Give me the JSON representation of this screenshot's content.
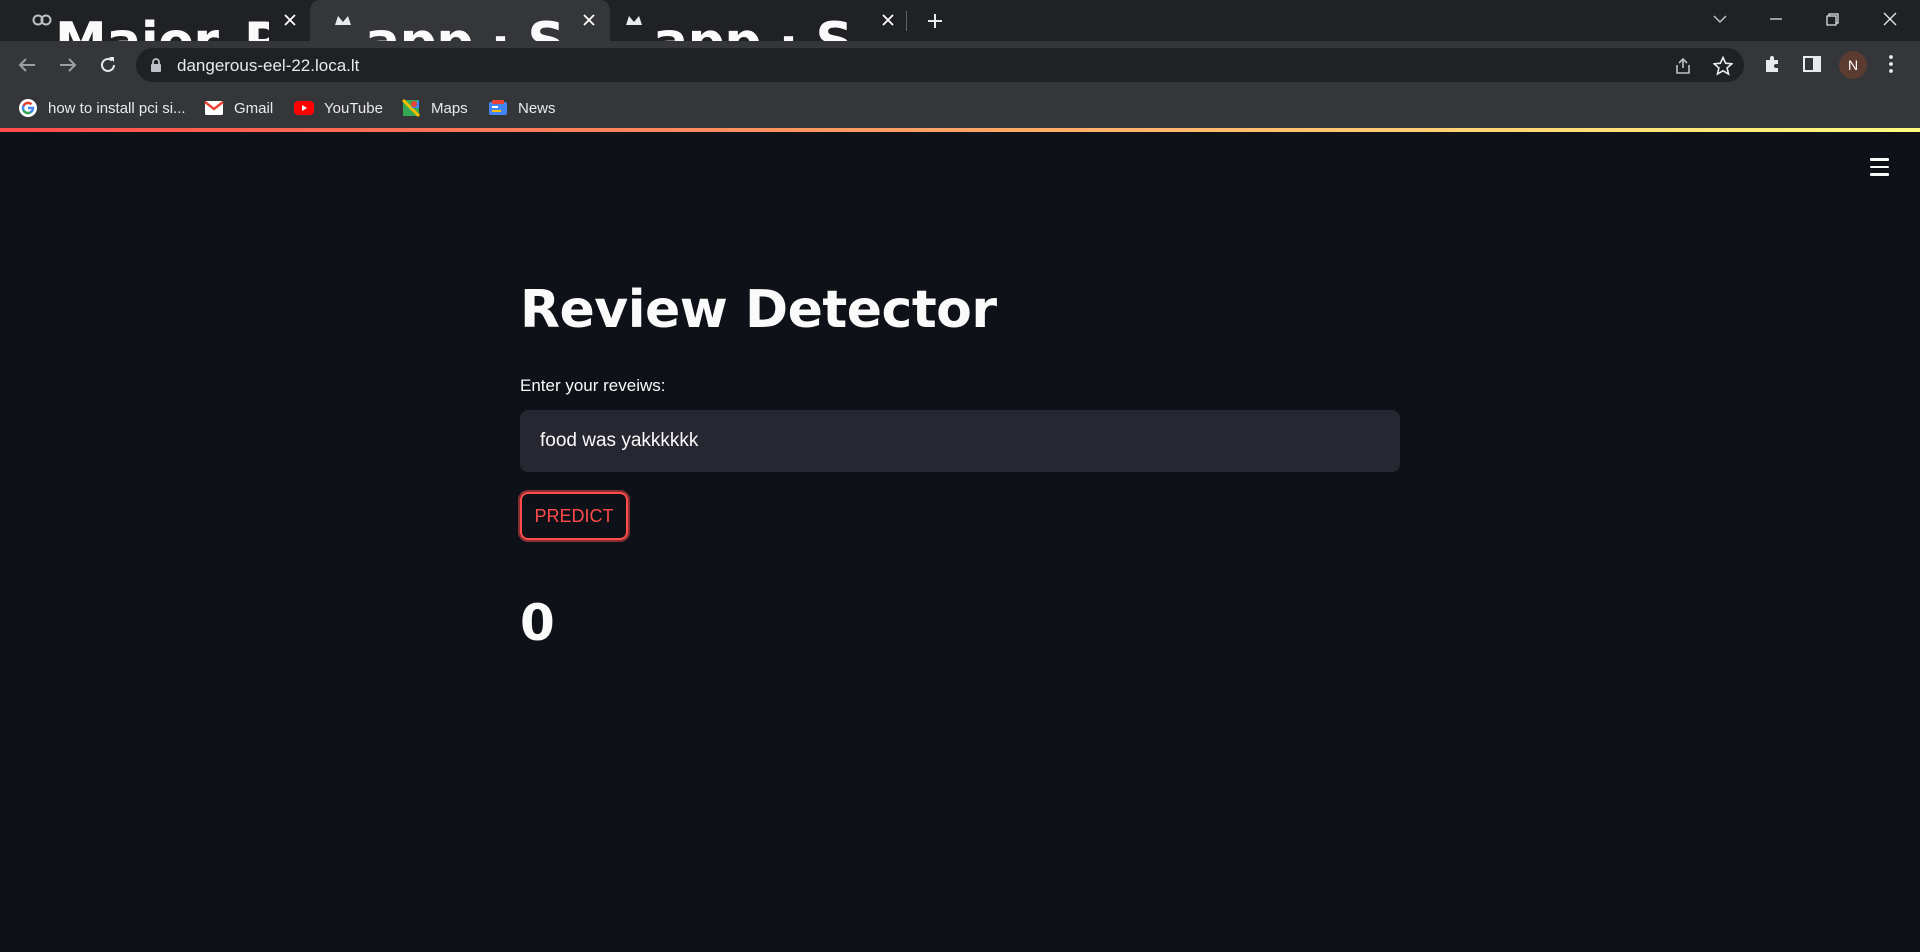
{
  "browser": {
    "tabs": [
      {
        "title": "Major_Project.ipynb - Colaboratory",
        "icon": "colab-icon",
        "active": false
      },
      {
        "title": "app · Streamlit",
        "icon": "streamlit-icon",
        "active": true
      },
      {
        "title": "app · Streamlit",
        "icon": "streamlit-icon",
        "active": false
      }
    ],
    "url": "dangerous-eel-22.loca.lt",
    "profile_initial": "N",
    "bookmarks": [
      {
        "label": "how to install pci si...",
        "icon": "google-icon"
      },
      {
        "label": "Gmail",
        "icon": "gmail-icon"
      },
      {
        "label": "YouTube",
        "icon": "youtube-icon"
      },
      {
        "label": "Maps",
        "icon": "maps-icon"
      },
      {
        "label": "News",
        "icon": "news-icon"
      }
    ]
  },
  "app": {
    "title": "Review Detector",
    "input_label": "Enter your reveiws:",
    "input_value": "food was yakkkkkk",
    "button_label": "PREDICT",
    "result": "0",
    "colors": {
      "background": "#0e1117",
      "accent": "#ff4b4b",
      "input_bg": "#262730",
      "text": "#fafafa"
    }
  }
}
